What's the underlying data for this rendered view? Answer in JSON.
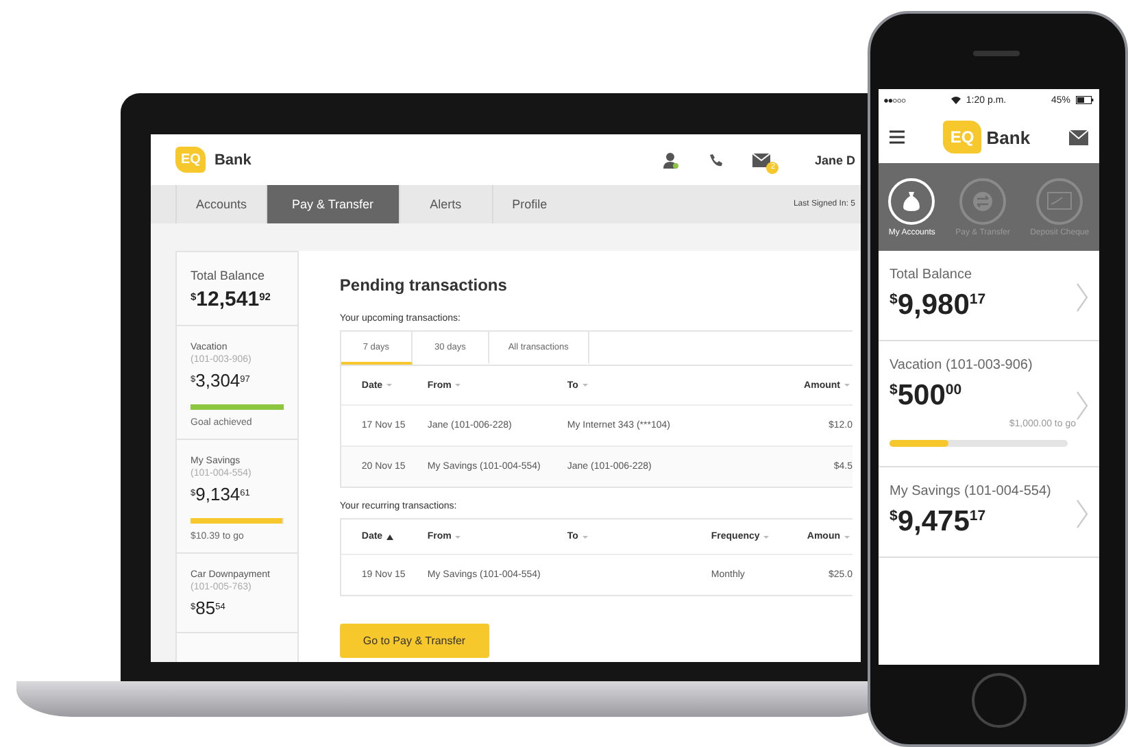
{
  "laptop": {
    "header": {
      "logo_mark": "EQ",
      "logo_text": "Bank",
      "message_badge": "2",
      "user_name": "Jane D"
    },
    "tabs": [
      {
        "label": "Accounts",
        "selected": false
      },
      {
        "label": "Pay & Transfer",
        "selected": true
      },
      {
        "label": "Alerts",
        "selected": false
      },
      {
        "label": "Profile",
        "selected": false
      }
    ],
    "last_signed_in": "Last Signed In: 5",
    "sidebar": [
      {
        "kind": "total",
        "name": "Total Balance",
        "currency": "$",
        "whole": "12,541",
        "cents": "92"
      },
      {
        "kind": "goal",
        "name": "Vacation",
        "account": "(101-003-906)",
        "currency": "$",
        "whole": "3,304",
        "cents": "97",
        "level": 1,
        "color": "#8cc63f",
        "note": "Goal achieved"
      },
      {
        "kind": "goal",
        "name": "My Savings",
        "account": "(101-004-554)",
        "currency": "$",
        "whole": "9,134",
        "cents": "61",
        "level": 0.99,
        "color": "#f7c82b",
        "note": "$10.39 to go"
      },
      {
        "kind": "plain",
        "name": "Car Downpayment",
        "account": "(101-005-763)",
        "currency": "$",
        "whole": "85",
        "cents": "54"
      }
    ],
    "title": "Pending transactions",
    "upcoming": {
      "label": "Your upcoming transactions:",
      "tabs": [
        {
          "label": "7 days",
          "selected": true
        },
        {
          "label": "30 days",
          "selected": false
        },
        {
          "label": "All transactions",
          "selected": false
        }
      ],
      "columns": [
        {
          "label": "Date",
          "sorted": false
        },
        {
          "label": "From",
          "sorted": false
        },
        {
          "label": "To",
          "sorted": false
        },
        {
          "label": "Amount",
          "sorted": false
        }
      ],
      "rows": [
        [
          "17 Nov 15",
          "Jane (101-006-228)",
          "My Internet 343 (***104)",
          "$12.0"
        ],
        [
          "20 Nov 15",
          "My Savings (101-004-554)",
          "Jane (101-006-228)",
          "$4.5"
        ]
      ]
    },
    "recurring": {
      "label": "Your recurring transactions:",
      "columns": [
        {
          "label": "Date",
          "sorted": true
        },
        {
          "label": "From",
          "sorted": false
        },
        {
          "label": "To",
          "sorted": false
        },
        {
          "label": "Frequency",
          "sorted": false
        },
        {
          "label": "Amoun",
          "sorted": false
        }
      ],
      "rows": [
        [
          "19 Nov 15",
          "My Savings (101-004-554)",
          "",
          "Monthly",
          "$25.0"
        ]
      ]
    },
    "button": "Go to Pay & Transfer"
  },
  "phone": {
    "status": {
      "time": "1:20 p.m.",
      "battery": "45%"
    },
    "header": {
      "logo_mark": "EQ",
      "logo_text": "Bank"
    },
    "nav": [
      {
        "label": "My Accounts",
        "kind": "money",
        "selected": true
      },
      {
        "label": "Pay & Transfer",
        "kind": "transfer",
        "selected": false
      },
      {
        "label": "Deposit Cheque",
        "kind": "cheque",
        "selected": false
      }
    ],
    "cards": [
      {
        "kind": "total",
        "name": "Total Balance",
        "currency": "$",
        "whole": "9,980",
        "cents": "17"
      },
      {
        "kind": "goal",
        "name": "Vacation (101-003-906)",
        "currency": "$",
        "whole": "500",
        "cents": "00",
        "note": "$1,000.00 to go",
        "level": 0.33
      },
      {
        "kind": "plain",
        "name": "My Savings (101-004-554)",
        "currency": "$",
        "whole": "9,475",
        "cents": "17"
      }
    ]
  }
}
